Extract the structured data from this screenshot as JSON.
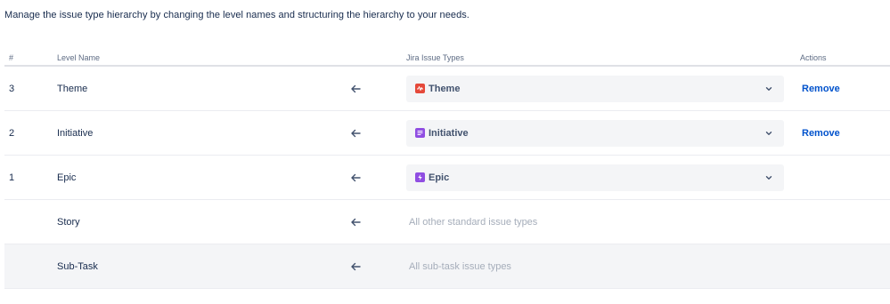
{
  "intro": "Manage the issue type hierarchy by changing the level names and structuring the hierarchy to your needs.",
  "headers": {
    "num": "#",
    "level_name": "Level Name",
    "issue_types": "Jira Issue Types",
    "actions": "Actions"
  },
  "rows": [
    {
      "num": "3",
      "name": "Theme",
      "type": "Theme",
      "icon": "theme-icon",
      "icon_color": "#e5493a",
      "action": "Remove"
    },
    {
      "num": "2",
      "name": "Initiative",
      "type": "Initiative",
      "icon": "initiative-icon",
      "icon_color": "#904ee2",
      "action": "Remove"
    },
    {
      "num": "1",
      "name": "Epic",
      "type": "Epic",
      "icon": "epic-icon",
      "icon_color": "#904ee2",
      "action": ""
    },
    {
      "num": "",
      "name": "Story",
      "type": "All other standard issue types",
      "action": ""
    },
    {
      "num": "",
      "name": "Sub-Task",
      "type": "All sub-task issue types",
      "action": ""
    }
  ],
  "colors": {
    "link": "#0052cc",
    "select_bg": "#f4f5f7",
    "muted": "#a5adba"
  }
}
